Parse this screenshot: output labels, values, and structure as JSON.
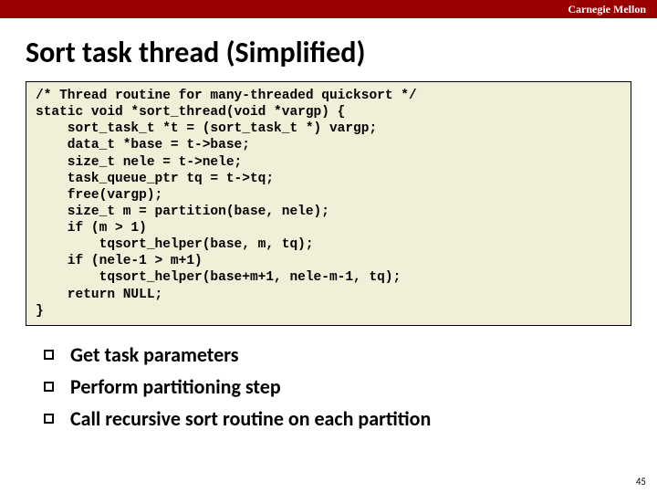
{
  "header": {
    "brand": "Carnegie Mellon"
  },
  "title": "Sort task thread (Simplified)",
  "code": "/* Thread routine for many-threaded quicksort */\nstatic void *sort_thread(void *vargp) {\n    sort_task_t *t = (sort_task_t *) vargp;\n    data_t *base = t->base;\n    size_t nele = t->nele;\n    task_queue_ptr tq = t->tq;\n    free(vargp);\n    size_t m = partition(base, nele);\n    if (m > 1)\n        tqsort_helper(base, m, tq);\n    if (nele-1 > m+1)\n        tqsort_helper(base+m+1, nele-m-1, tq);\n    return NULL;\n}",
  "bullets": [
    "Get task parameters",
    "Perform partitioning step",
    "Call recursive sort routine on each partition"
  ],
  "page_number": "45"
}
